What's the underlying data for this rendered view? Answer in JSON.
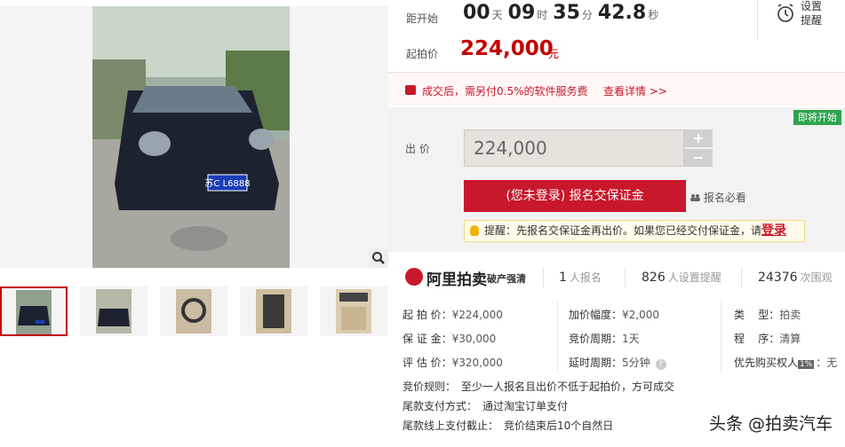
{
  "gallery": {
    "plate_text": "苏C L6888",
    "zoom_icon": "magnifier-icon",
    "thumbnails": [
      {
        "name": "thumb-1"
      },
      {
        "name": "thumb-2"
      },
      {
        "name": "thumb-3"
      },
      {
        "name": "thumb-4"
      },
      {
        "name": "thumb-5"
      }
    ]
  },
  "countdown": {
    "label": "距开始",
    "days": "00",
    "days_unit": "天",
    "hours": "09",
    "hours_unit": "时",
    "minutes": "35",
    "minutes_unit": "分",
    "seconds": "42.8",
    "seconds_unit": "秒"
  },
  "start_price": {
    "label": "起拍价",
    "value": "224,000",
    "unit": "元"
  },
  "settings": {
    "label": "设置提醒",
    "icon": "alarm-clock-icon"
  },
  "notice": {
    "text": "成交后，需另付0.5%的软件服务费",
    "link": "查看详情 >>"
  },
  "bid": {
    "badge": "即将开始",
    "label": "出  价",
    "amount": "224,000",
    "plus": "+",
    "minus": "−",
    "signup_button": "(您未登录) 报名交保证金",
    "must_read": "报名必看",
    "tip_prefix": "提醒：先报名交保证金再出价。如果您已经交付保证金，请",
    "tip_login": "登录"
  },
  "brand": {
    "name": "阿里拍卖",
    "sub": "破产强清",
    "signups_value": "1",
    "signups_label": "人报名",
    "reminders_value": "826",
    "reminders_label": "人设置提醒",
    "views_value": "24376",
    "views_label": "次围观"
  },
  "info": {
    "start_price": {
      "k": "起 拍 价：",
      "v": "¥224,000"
    },
    "deposit": {
      "k": "保 证 金：",
      "v": "¥30,000"
    },
    "appraisal": {
      "k": "评 估 价：",
      "v": "¥320,000"
    },
    "increment": {
      "k": "加价幅度：",
      "v": "¥2,000"
    },
    "bid_cycle": {
      "k": "竞价周期：",
      "v": "1天"
    },
    "delay_cycle": {
      "k": "延时周期：",
      "v": "5分钟"
    },
    "type": {
      "k": "类    型：",
      "v": "拍卖"
    },
    "procedure": {
      "k": "程    序：",
      "v": "清算"
    },
    "priority": {
      "k": "优先购买权人",
      "tag": "1%",
      "v": "：无"
    }
  },
  "rules": {
    "bid_rule_k": "竞价规则：",
    "bid_rule_v": "至少一人报名且出价不低于起拍价，方可成交",
    "payment_k": "尾款支付方式：",
    "payment_v": "通过淘宝订单支付",
    "deadline_k": "尾款线上支付截止：",
    "deadline_v": "竞价结束后10个自然日"
  },
  "watermark": "头条 @拍卖汽车",
  "colors": {
    "accent": "#c8182c",
    "badge_green": "#2ea44f",
    "tip_bg": "#fffbea"
  }
}
